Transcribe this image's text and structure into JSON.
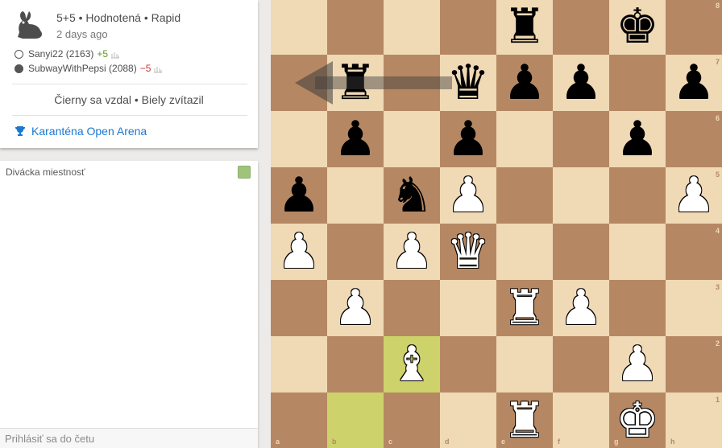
{
  "game": {
    "title": "5+5 • Hodnotená • Rapid",
    "time_ago": "2 days ago",
    "players": [
      {
        "name": "Sanyi22 (2163)",
        "diff": "+5",
        "color": "white"
      },
      {
        "name": "SubwayWithPepsi (2088)",
        "diff": "−5",
        "color": "black"
      }
    ],
    "result": "Čierny sa vzdal • Biely zvítazil",
    "tournament": "Karanténa Open Arena",
    "icon": "rabbit-icon"
  },
  "chat": {
    "title": "Divácka miestnosť",
    "input_placeholder": "Prihlásiť sa do četu"
  },
  "board": {
    "light": "#f0d9b5",
    "dark": "#b58863",
    "highlight_light": "#cdd26a",
    "highlight_dark": "#aaa23a",
    "highlights": [
      "c2",
      "b1"
    ],
    "arrow": {
      "from": "d7",
      "to": "a7"
    },
    "files": [
      "a",
      "b",
      "c",
      "d",
      "e",
      "f",
      "g",
      "h"
    ],
    "ranks": [
      "8",
      "7",
      "6",
      "5",
      "4",
      "3",
      "2",
      "1"
    ],
    "pieces": [
      {
        "sq": "e8",
        "p": "r"
      },
      {
        "sq": "g8",
        "p": "k"
      },
      {
        "sq": "b7",
        "p": "r"
      },
      {
        "sq": "d7",
        "p": "q"
      },
      {
        "sq": "e7",
        "p": "p"
      },
      {
        "sq": "f7",
        "p": "p"
      },
      {
        "sq": "h7",
        "p": "p"
      },
      {
        "sq": "b6",
        "p": "p"
      },
      {
        "sq": "d6",
        "p": "p"
      },
      {
        "sq": "g6",
        "p": "p"
      },
      {
        "sq": "a5",
        "p": "p"
      },
      {
        "sq": "c5",
        "p": "n"
      },
      {
        "sq": "d5",
        "p": "P"
      },
      {
        "sq": "h5",
        "p": "P"
      },
      {
        "sq": "a4",
        "p": "P"
      },
      {
        "sq": "c4",
        "p": "P"
      },
      {
        "sq": "d4",
        "p": "Q"
      },
      {
        "sq": "b3",
        "p": "P"
      },
      {
        "sq": "e3",
        "p": "R"
      },
      {
        "sq": "f3",
        "p": "P"
      },
      {
        "sq": "c2",
        "p": "B"
      },
      {
        "sq": "g2",
        "p": "P"
      },
      {
        "sq": "e1",
        "p": "R"
      },
      {
        "sq": "g1",
        "p": "K"
      }
    ]
  }
}
